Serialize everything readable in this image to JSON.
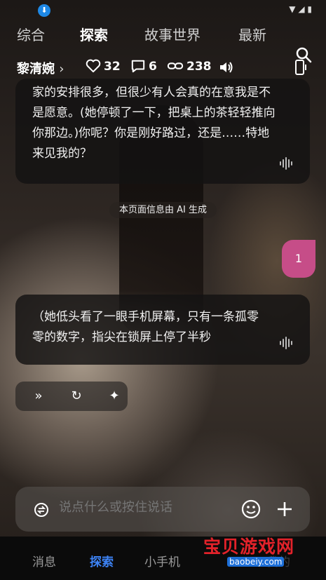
{
  "status_bar": {
    "notification_icon": "download-icon",
    "system_icons": "▼ ◢ ▮"
  },
  "tabs": [
    {
      "label": "综合"
    },
    {
      "label": "探索"
    },
    {
      "label": "故事世界"
    },
    {
      "label": "最新"
    }
  ],
  "character": {
    "name": "黎清婉",
    "likes": "32",
    "comments": "6",
    "shares": "238"
  },
  "messages": {
    "ai_1": "家的安排很多，但很少有人会真的在意我是不是愿意。(她停顿了一下，把桌上的茶轻轻推向你那边。)你呢？你是刚好路过，还是……特地来见我的？",
    "ai_note": "本页面信息由 AI 生成",
    "user_1": "1",
    "ai_2": "（她低头看了一眼手机屏幕，只有一条孤零零的数字，指尖在锁屏上停了半秒"
  },
  "input": {
    "placeholder": "说点什么或按住说话"
  },
  "bottom_nav": [
    {
      "label": "消息"
    },
    {
      "label": "探索"
    },
    {
      "label": "小手机"
    },
    {
      "label": "我的"
    }
  ],
  "watermark": {
    "text": "宝贝游戏网",
    "url": "baobeiy.com"
  },
  "colors": {
    "accent": "#3d83f5",
    "user_bubble": "#c64d88",
    "watermark": "#e2222a"
  }
}
